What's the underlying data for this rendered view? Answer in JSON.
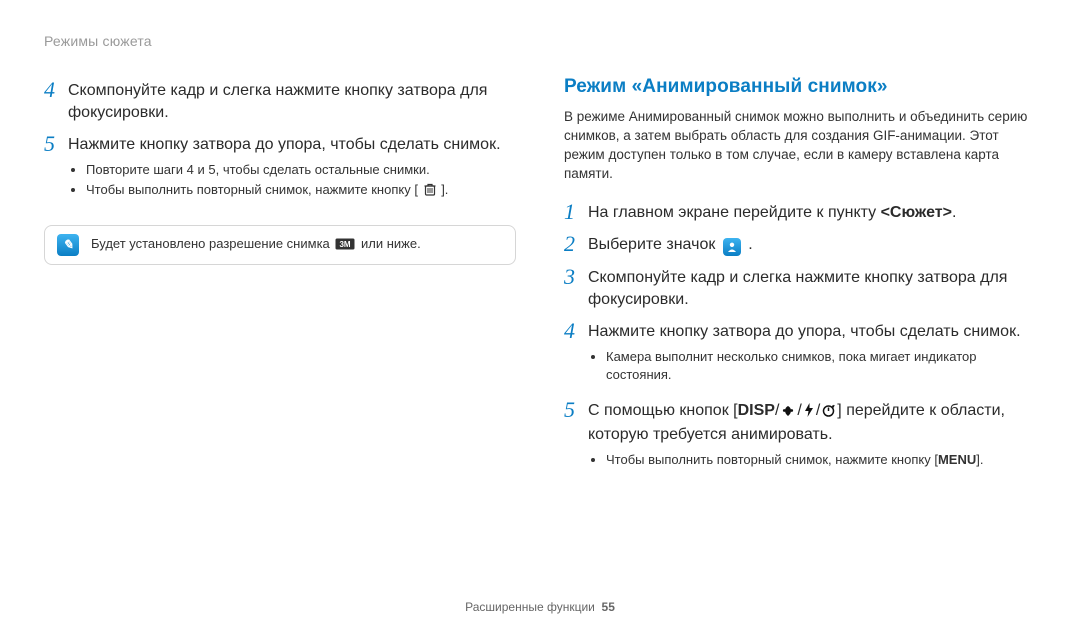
{
  "header": "Режимы сюжета",
  "left": {
    "s4": "Скомпонуйте кадр и слегка нажмите кнопку затвора для фокусировки.",
    "s5": "Нажмите кнопку затвора до упора, чтобы сделать снимок.",
    "s5_b1": "Повторите шаги 4 и 5, чтобы сделать остальные снимки.",
    "s5_b2_pre": "Чтобы выполнить повторный снимок, нажмите кнопку [",
    "s5_b2_post": "].",
    "note_pre": "Будет установлено разрешение снимка ",
    "note_mid": "",
    "note_post": " или ниже."
  },
  "right": {
    "title": "Режим «Анимированный снимок»",
    "intro": "В режиме Анимированный снимок можно выполнить и объединить серию снимков, а затем выбрать область для создания GIF-анимации. Этот режим доступен только в том случае, если в камеру вставлена карта памяти.",
    "s1_pre": "На главном экране перейдите к пункту ",
    "s1_bold": "<Сюжет>",
    "s1_post": ".",
    "s2_pre": "Выберите значок ",
    "s2_post": ".",
    "s3": "Скомпонуйте кадр и слегка нажмите кнопку затвора для фокусировки.",
    "s4": "Нажмите кнопку затвора до упора, чтобы сделать снимок.",
    "s4_b1": "Камера выполнит несколько снимков, пока мигает индикатор состояния.",
    "s5_pre": "С помощью кнопок [",
    "s5_disp": "DISP",
    "s5_mid1": "/",
    "s5_mid2": "/",
    "s5_mid3": "/",
    "s5_post": "] перейдите к области, которую требуется анимировать.",
    "s5_b1_pre": "Чтобы выполнить повторный снимок, нажмите кнопку [",
    "s5_b1_key": "MENU",
    "s5_b1_post": "]."
  },
  "footer_label": "Расширенные функции",
  "footer_page": "55"
}
